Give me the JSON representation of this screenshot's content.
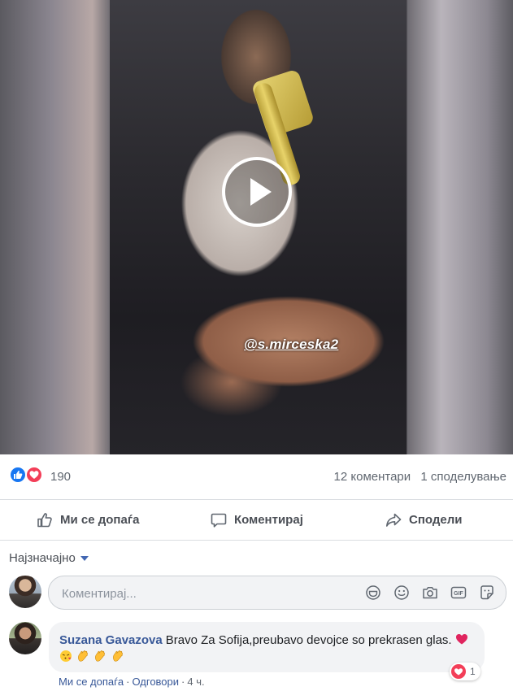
{
  "video": {
    "overlay_tag": "@s.mirceska2",
    "play_icon": "play-icon"
  },
  "reactions": {
    "icons": [
      "like-reaction-icon",
      "love-reaction-icon"
    ],
    "count": "190",
    "comments_count": "12 коментари",
    "shares_count": "1 споделување"
  },
  "actions": {
    "like_label": "Ми се допаѓа",
    "comment_label": "Коментирај",
    "share_label": "Сподели"
  },
  "sort": {
    "label": "Најзначајно"
  },
  "comment_input": {
    "placeholder": "Коментирај...",
    "icons": [
      "sticker-face-icon",
      "emoji-icon",
      "camera-icon",
      "gif-icon",
      "sticker-icon"
    ]
  },
  "comments": [
    {
      "author": "Suzana Gavazova",
      "text": "Bravo Za Sofija,preubavo devojce so prekrasen glas.",
      "emojis": [
        "red-heart",
        "face-blowing-kiss",
        "clapping-hands",
        "clapping-hands",
        "clapping-hands"
      ],
      "like_label": "Ми се допаѓа",
      "reply_label": "Одговори",
      "time": "4 ч.",
      "reaction_count": "1"
    }
  ],
  "colors": {
    "link": "#385898",
    "like_blue": "#1877f2",
    "love_red": "#f33e58",
    "muted_text": "#606770"
  }
}
